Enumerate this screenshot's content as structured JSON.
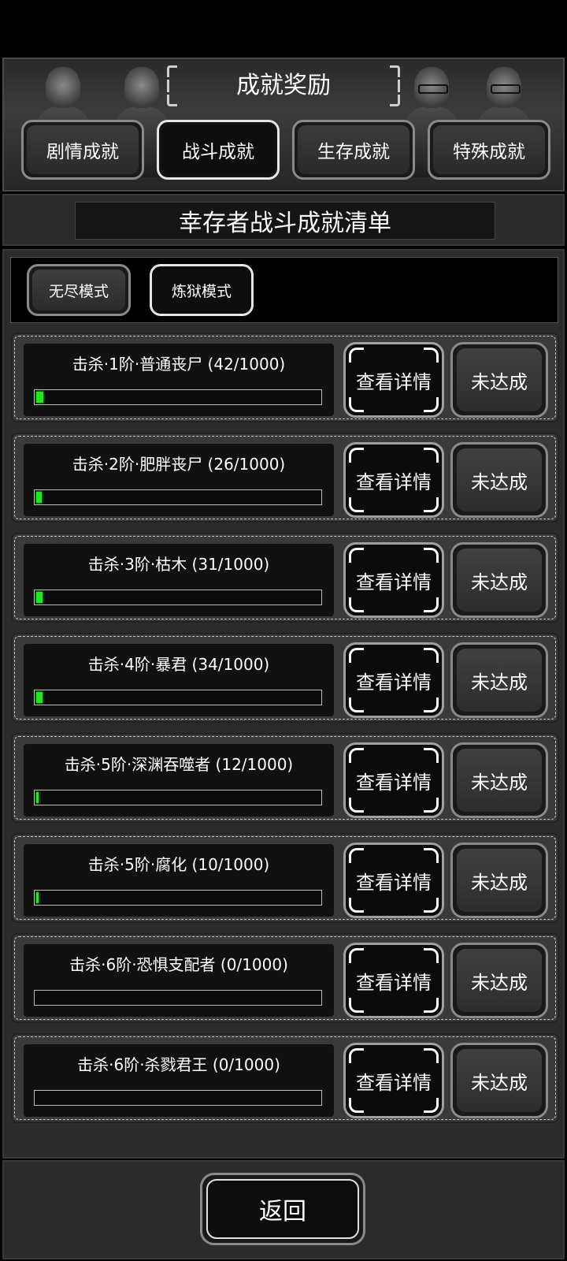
{
  "header": {
    "title": "成就奖励"
  },
  "tabs": [
    {
      "label": "剧情成就",
      "active": false
    },
    {
      "label": "战斗成就",
      "active": true
    },
    {
      "label": "生存成就",
      "active": false
    },
    {
      "label": "特殊成就",
      "active": false
    }
  ],
  "section": {
    "title": "幸存者战斗成就清单"
  },
  "modes": [
    {
      "label": "无尽模式",
      "active": false
    },
    {
      "label": "炼狱模式",
      "active": true
    }
  ],
  "achievements": [
    {
      "label": "击杀·1阶·普通丧尸 (42/1000)",
      "progress": 42,
      "goal": 1000,
      "detail_label": "查看详情",
      "status_label": "未达成"
    },
    {
      "label": "击杀·2阶·肥胖丧尸 (26/1000)",
      "progress": 26,
      "goal": 1000,
      "detail_label": "查看详情",
      "status_label": "未达成"
    },
    {
      "label": "击杀·3阶·枯木 (31/1000)",
      "progress": 31,
      "goal": 1000,
      "detail_label": "查看详情",
      "status_label": "未达成"
    },
    {
      "label": "击杀·4阶·暴君 (34/1000)",
      "progress": 34,
      "goal": 1000,
      "detail_label": "查看详情",
      "status_label": "未达成"
    },
    {
      "label": "击杀·5阶·深渊吞噬者 (12/1000)",
      "progress": 12,
      "goal": 1000,
      "detail_label": "查看详情",
      "status_label": "未达成"
    },
    {
      "label": "击杀·5阶·腐化 (10/1000)",
      "progress": 10,
      "goal": 1000,
      "detail_label": "查看详情",
      "status_label": "未达成"
    },
    {
      "label": "击杀·6阶·恐惧支配者 (0/1000)",
      "progress": 0,
      "goal": 1000,
      "detail_label": "查看详情",
      "status_label": "未达成"
    },
    {
      "label": "击杀·6阶·杀戮君王 (0/1000)",
      "progress": 0,
      "goal": 1000,
      "detail_label": "查看详情",
      "status_label": "未达成"
    }
  ],
  "footer": {
    "back_label": "返回"
  },
  "colors": {
    "progress_fill": "#1ee81e",
    "background": "#000000",
    "panel": "#2b2b2b"
  }
}
